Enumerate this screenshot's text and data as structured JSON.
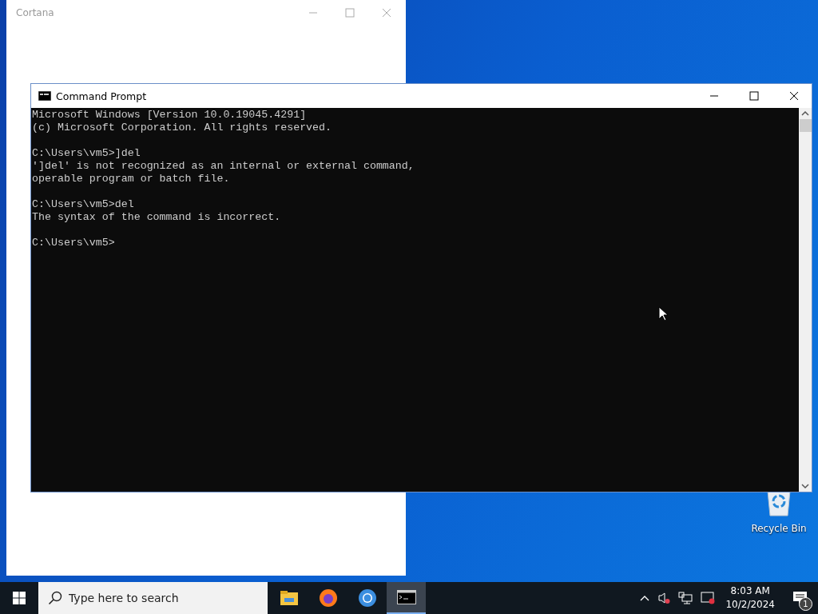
{
  "background_window": {
    "title": "Cortana"
  },
  "console_window": {
    "title": "Command Prompt",
    "blocks": [
      [
        "Microsoft Windows [Version 10.0.19045.4291]",
        "(c) Microsoft Corporation. All rights reserved."
      ],
      [
        "C:\\Users\\vm5>]del",
        "']del' is not recognized as an internal or external command,",
        "operable program or batch file."
      ],
      [
        "C:\\Users\\vm5>del",
        "The syntax of the command is incorrect."
      ],
      [
        "C:\\Users\\vm5>"
      ]
    ]
  },
  "desktop_icons": [
    {
      "label": "Recycle Bin"
    }
  ],
  "taskbar": {
    "search": {
      "placeholder": "Type here to search"
    },
    "apps": [
      {
        "kind": "folder",
        "selected": false
      },
      {
        "kind": "firefox",
        "selected": false
      },
      {
        "kind": "chrome",
        "selected": false
      },
      {
        "kind": "console",
        "selected": true
      }
    ],
    "clock": {
      "time": "8:03 AM",
      "date": "10/2/2024"
    },
    "notifications": {
      "count": "1"
    }
  }
}
